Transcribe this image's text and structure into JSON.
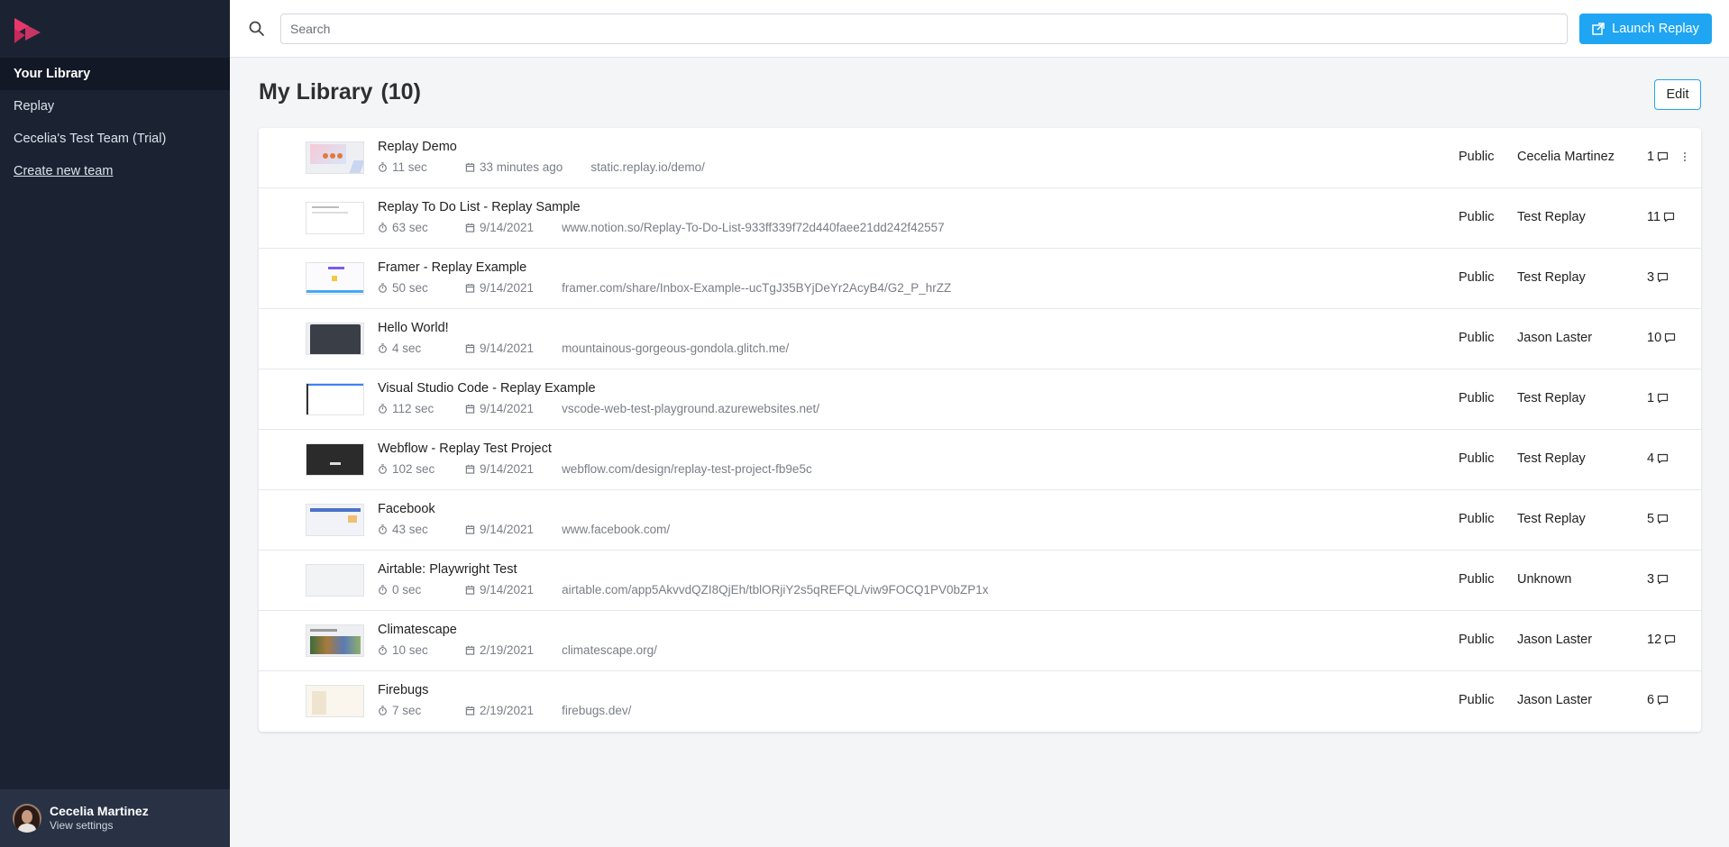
{
  "sidebar": {
    "nav": [
      {
        "label": "Your Library",
        "active": true
      },
      {
        "label": "Replay"
      },
      {
        "label": "Cecelia's Test Team (Trial)"
      },
      {
        "label": "Create new team",
        "link": true
      }
    ],
    "user": {
      "name": "Cecelia Martinez",
      "sub": "View settings"
    }
  },
  "topbar": {
    "search_placeholder": "Search",
    "launch_label": "Launch Replay"
  },
  "library": {
    "title": "My Library",
    "count": "(10)",
    "edit_label": "Edit"
  },
  "rows": [
    {
      "title": "Replay Demo",
      "duration": "11 sec",
      "date": "33 minutes ago",
      "url": "static.replay.io/demo/",
      "privacy": "Public",
      "owner": "Cecelia Martinez",
      "comments": "1"
    },
    {
      "title": "Replay To Do List - Replay Sample",
      "duration": "63 sec",
      "date": "9/14/2021",
      "url": "www.notion.so/Replay-To-Do-List-933ff339f72d440faee21dd242f42557",
      "privacy": "Public",
      "owner": "Test Replay",
      "comments": "11"
    },
    {
      "title": "Framer - Replay Example",
      "duration": "50 sec",
      "date": "9/14/2021",
      "url": "framer.com/share/Inbox-Example--ucTgJ35BYjDeYr2AcyB4/G2_P_hrZZ",
      "privacy": "Public",
      "owner": "Test Replay",
      "comments": "3"
    },
    {
      "title": "Hello World!",
      "duration": "4 sec",
      "date": "9/14/2021",
      "url": "mountainous-gorgeous-gondola.glitch.me/",
      "privacy": "Public",
      "owner": "Jason Laster",
      "comments": "10"
    },
    {
      "title": "Visual Studio Code - Replay Example",
      "duration": "112 sec",
      "date": "9/14/2021",
      "url": "vscode-web-test-playground.azurewebsites.net/",
      "privacy": "Public",
      "owner": "Test Replay",
      "comments": "1"
    },
    {
      "title": "Webflow - Replay Test Project",
      "duration": "102 sec",
      "date": "9/14/2021",
      "url": "webflow.com/design/replay-test-project-fb9e5c",
      "privacy": "Public",
      "owner": "Test Replay",
      "comments": "4"
    },
    {
      "title": "Facebook",
      "duration": "43 sec",
      "date": "9/14/2021",
      "url": "www.facebook.com/",
      "privacy": "Public",
      "owner": "Test Replay",
      "comments": "5"
    },
    {
      "title": "Airtable: Playwright Test",
      "duration": "0 sec",
      "date": "9/14/2021",
      "url": "airtable.com/app5AkvvdQZI8QjEh/tblORjiY2s5qREFQL/viw9FOCQ1PV0bZP1x",
      "privacy": "Public",
      "owner": "Unknown",
      "comments": "3"
    },
    {
      "title": "Climatescape",
      "duration": "10 sec",
      "date": "2/19/2021",
      "url": "climatescape.org/",
      "privacy": "Public",
      "owner": "Jason Laster",
      "comments": "12"
    },
    {
      "title": "Firebugs",
      "duration": "7 sec",
      "date": "2/19/2021",
      "url": "firebugs.dev/",
      "privacy": "Public",
      "owner": "Jason Laster",
      "comments": "6"
    }
  ],
  "colors": {
    "sidebar_bg": "#1b2333",
    "accent": "#1fa5f2",
    "logo": "#e8386b"
  },
  "icons": {
    "logo": "replay-logo-icon",
    "search": "search-icon",
    "launch": "external-link-icon",
    "duration": "timer-icon",
    "date": "calendar-icon",
    "comments": "comment-icon",
    "more": "kebab-menu-icon"
  }
}
